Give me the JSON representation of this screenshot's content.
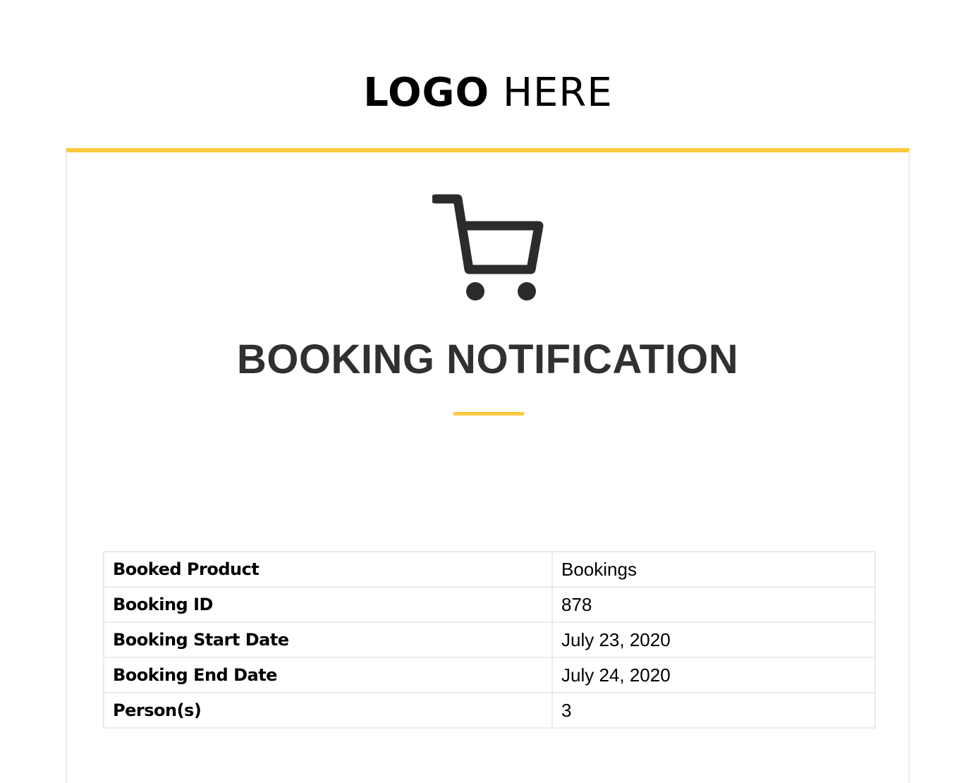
{
  "logo": {
    "bold_text": "LOGO",
    "light_text": "HERE"
  },
  "colors": {
    "accent": "#ffc93c",
    "heading": "#303030",
    "border": "#ebebeb"
  },
  "notification": {
    "icon": "shopping-cart-icon",
    "title": "BOOKING NOTIFICATION"
  },
  "details": {
    "rows": [
      {
        "label": "Booked Product",
        "value": "Bookings"
      },
      {
        "label": "Booking ID",
        "value": "878"
      },
      {
        "label": "Booking Start Date",
        "value": "July 23, 2020"
      },
      {
        "label": "Booking End Date",
        "value": "July 24, 2020"
      },
      {
        "label": "Person(s)",
        "value": "3"
      }
    ]
  }
}
